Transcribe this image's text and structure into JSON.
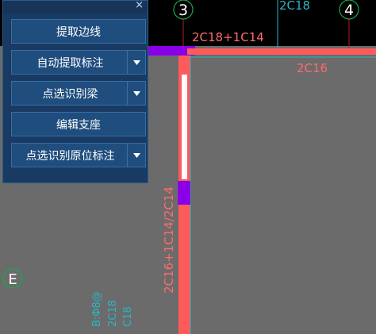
{
  "panel": {
    "close_glyph": "×",
    "buttons": [
      {
        "label": "提取边线",
        "has_dropdown": false
      },
      {
        "label": "自动提取标注",
        "has_dropdown": true
      },
      {
        "label": "点选识别梁",
        "has_dropdown": true
      },
      {
        "label": "编辑支座",
        "has_dropdown": false
      },
      {
        "label": "点选识别原位标注",
        "has_dropdown": true
      }
    ]
  },
  "drawing": {
    "axes": {
      "axis_3": "3",
      "axis_4": "4",
      "axis_E": "E"
    },
    "annotations": {
      "top_rebar": "2C18+1C14",
      "top_partial": "2C18",
      "right_beam": "2C16",
      "vertical_beam": "2C16+1C14/2C14",
      "bottom_partial_1": "B:Φ8@",
      "bottom_partial_2": "2C18",
      "bottom_partial_3": "C18"
    }
  },
  "colors": {
    "background": "#6b6b6b",
    "beam_red": "#ff5a5a",
    "beam_magenta": "#8a00e6",
    "grid_green": "#19a84b",
    "cyan_text": "#27b7c4"
  }
}
